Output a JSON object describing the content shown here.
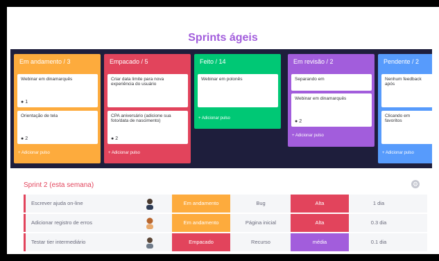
{
  "title": "Sprints ágeis",
  "board": {
    "columns": [
      {
        "header": "Em andamento / 3",
        "color": "#fdab3d",
        "cards": [
          {
            "text": "Webinar em dinamarquês",
            "comments": "1"
          },
          {
            "text": "Orientação de tela",
            "comments": "2"
          }
        ],
        "add": "+ Adicionar pulso"
      },
      {
        "header": "Empacado / 5",
        "color": "#e2445c",
        "cards": [
          {
            "text": "Criar data limite para nova experiência do usuário",
            "comments": ""
          },
          {
            "text": "CPA aniversário (adicione sua foto/data de nascimento)",
            "comments": "2"
          }
        ],
        "add": "+ Adicionar pulso"
      },
      {
        "header": "Feito / 14",
        "color": "#00c875",
        "cards": [
          {
            "text": "Webinar em polonês",
            "comments": ""
          }
        ],
        "add": "+ Adicionar pulso"
      },
      {
        "header": "Em revisão / 2",
        "color": "#a25ddc",
        "cards": [
          {
            "text": "Separando em",
            "comments": ""
          },
          {
            "text": "Webinar em dinamarquês",
            "comments": "2"
          }
        ],
        "add": "+ Adicionar pulso"
      },
      {
        "header": "Pendente / 2",
        "color": "#579bfc",
        "cards": [
          {
            "text": "Nenhum feedback após",
            "comments": ""
          },
          {
            "text": "Clicando em favoritos",
            "comments": ""
          }
        ],
        "add": "+ Adicionar pulso"
      }
    ]
  },
  "sprint": {
    "title": "Sprint 2 (esta semana)",
    "rows": [
      {
        "name": "Escrever ajuda on-line",
        "status": "Em andamento",
        "status_color": "#fdab3d",
        "type": "Bug",
        "priority": "Alta",
        "priority_color": "#e2445c",
        "time": "1 dia"
      },
      {
        "name": "Adicionar registro de erros",
        "status": "Em andamento",
        "status_color": "#fdab3d",
        "type": "Página inicial",
        "priority": "Alta",
        "priority_color": "#e2445c",
        "time": "0.3 dia"
      },
      {
        "name": "Testar tier intermediário",
        "status": "Empacado",
        "status_color": "#e2445c",
        "type": "Recurso",
        "priority": "média",
        "priority_color": "#a25ddc",
        "time": "0.1 dia"
      }
    ]
  }
}
